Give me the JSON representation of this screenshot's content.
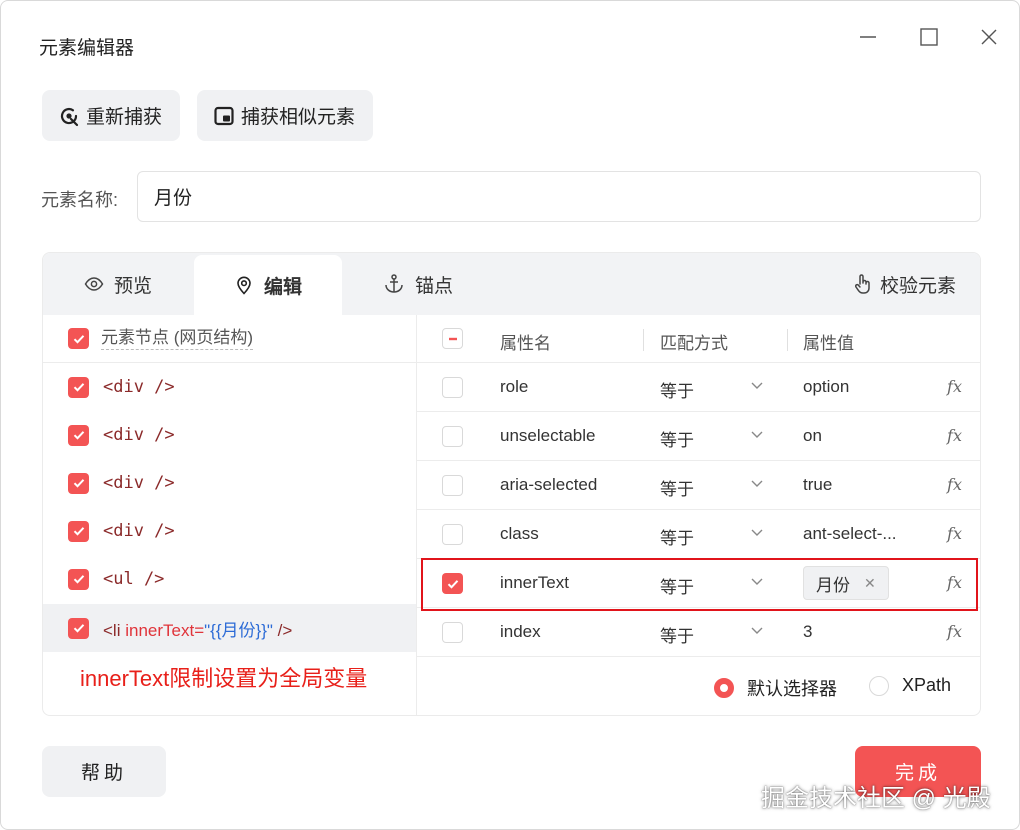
{
  "window": {
    "title": "元素编辑器"
  },
  "toolbar": {
    "recapture_label": "重新捕获",
    "capture_similar_label": "捕获相似元素"
  },
  "element_name": {
    "label": "元素名称:",
    "value": "月份"
  },
  "tabs": [
    {
      "label": "预览",
      "icon": "eye-icon"
    },
    {
      "label": "编辑",
      "icon": "location-pin-icon",
      "active": true
    },
    {
      "label": "锚点",
      "icon": "anchor-icon"
    }
  ],
  "validate_label": "校验元素",
  "tree": {
    "header": "元素节点 (网页结构)",
    "nodes": [
      {
        "tag": "<div />"
      },
      {
        "tag": "<div />"
      },
      {
        "tag": "<div />"
      },
      {
        "tag": "<div />"
      },
      {
        "tag": "<ul />"
      }
    ],
    "selected": {
      "prefix": "<li ",
      "attr": "innerText",
      "eq": "=",
      "value": "\"{{月份}}\"",
      "suffix": " />"
    }
  },
  "attributes": {
    "columns": {
      "name": "属性名",
      "match": "匹配方式",
      "value": "属性值"
    },
    "fx_label": "fx",
    "rows": [
      {
        "name": "role",
        "match": "等于",
        "value": "option",
        "checked": false
      },
      {
        "name": "unselectable",
        "match": "等于",
        "value": "on",
        "checked": false
      },
      {
        "name": "aria-selected",
        "match": "等于",
        "value": "true",
        "checked": false
      },
      {
        "name": "class",
        "match": "等于",
        "value": "ant-select-...",
        "checked": false
      },
      {
        "name": "innerText",
        "match": "等于",
        "value": "月份",
        "checked": true,
        "chip": true
      },
      {
        "name": "index",
        "match": "等于",
        "value": "3",
        "checked": false
      }
    ]
  },
  "annotation": "innerText限制设置为全局变量",
  "selector_mode": {
    "default_label": "默认选择器",
    "xpath_label": "XPath",
    "selected": "default"
  },
  "footer": {
    "help_label": "帮助",
    "done_label": "完成"
  },
  "watermark": "掘金技术社区 @ 光殿",
  "colors": {
    "accent": "#f35454",
    "highlight_border": "#e1141b",
    "annotation": "#e8201a"
  }
}
